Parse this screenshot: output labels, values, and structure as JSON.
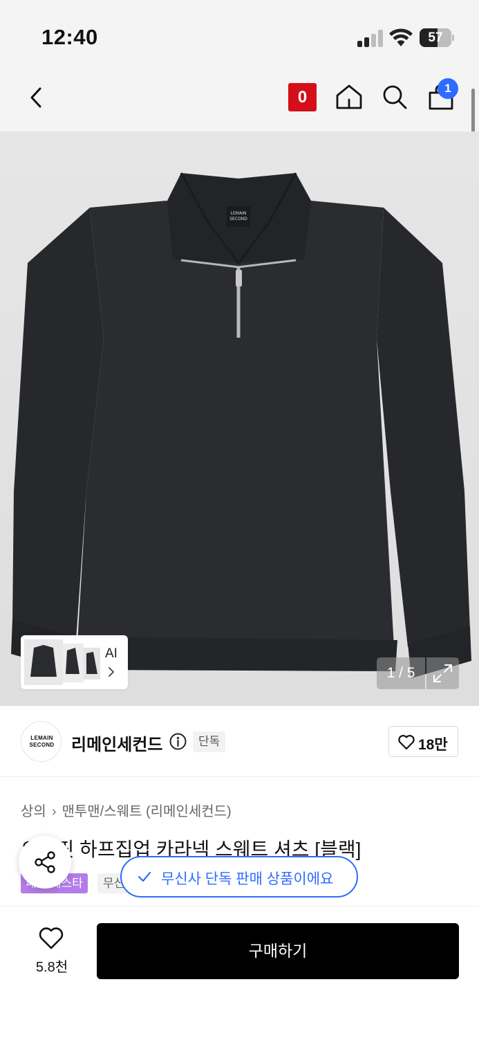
{
  "status_bar": {
    "time": "12:40",
    "battery": "57",
    "battery_level": 0.57,
    "icons": [
      "signal-icon",
      "wifi-icon",
      "battery-icon"
    ]
  },
  "nav": {
    "badge_count": "0",
    "cart_count": "1",
    "colors": {
      "badge": "#d40f19",
      "cart_count": "#2e6bff"
    },
    "icons": [
      "back-icon",
      "home-icon",
      "search-icon",
      "cart-icon"
    ]
  },
  "gallery": {
    "counter": "1 / 5",
    "ai_label": "AI",
    "icons": [
      "expand-icon",
      "chevron-right-icon"
    ]
  },
  "brand": {
    "name": "리메인세컨드",
    "logo_text": [
      "LEMAIN",
      "SECOND"
    ],
    "tag": "단독",
    "likes": "18만",
    "icons": [
      "info-icon",
      "heart-icon"
    ]
  },
  "product": {
    "breadcrumb": [
      "상의",
      "맨투맨/스웨트 (리메인세컨드)"
    ],
    "title": "오버핏 하프집업 카라넥 스웨트 셔츠 [블랙]",
    "badges": [
      "패션 페스타",
      "무신사"
    ],
    "colors": {
      "festa_badge": "#b47ce8"
    }
  },
  "toast": {
    "text": "무신사 단독 판매 상품이에요",
    "color": "#2e6bff",
    "icon": "check-icon"
  },
  "share": {
    "icon": "share-icon"
  },
  "bottom_bar": {
    "wish_count": "5.8천",
    "buy_label": "구매하기",
    "icon": "heart-icon"
  }
}
